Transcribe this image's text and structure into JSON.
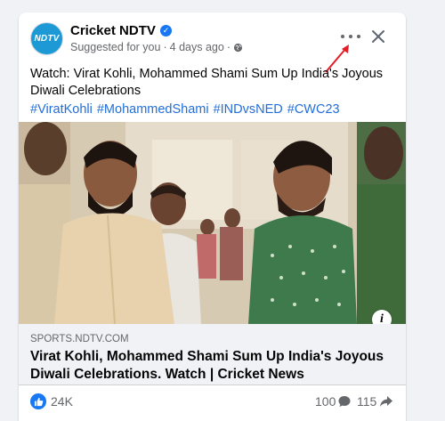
{
  "post": {
    "page_name": "Cricket NDTV",
    "avatar_text": "NDTV",
    "suggested_label": "Suggested for you",
    "separator": "·",
    "time_ago": "4 days ago",
    "separator2": "·",
    "text": "Watch: Virat Kohli, Mohammed Shami Sum Up India's Joyous Diwali Celebrations",
    "hashtags": [
      "#ViratKohli",
      "#MohammedShami",
      "#INDvsNED",
      "#CWC23"
    ],
    "info_label": "i"
  },
  "link_preview": {
    "domain": "SPORTS.NDTV.COM",
    "title": "Virat Kohli, Mohammed Shami Sum Up India's Joyous Diwali Celebrations. Watch | Cricket News"
  },
  "reactions": {
    "likes": "24K",
    "comments": "100",
    "shares": "115"
  },
  "icons": [
    "verified-badge-icon",
    "globe-icon",
    "more-options-icon",
    "close-icon",
    "red-arrow-annotation",
    "info-icon",
    "like-icon",
    "comment-icon",
    "share-icon"
  ],
  "colors": {
    "accent": "#1877f2",
    "hashtag": "#216fdb",
    "annotation_arrow": "#e41e26",
    "background": "#f0f2f5"
  }
}
